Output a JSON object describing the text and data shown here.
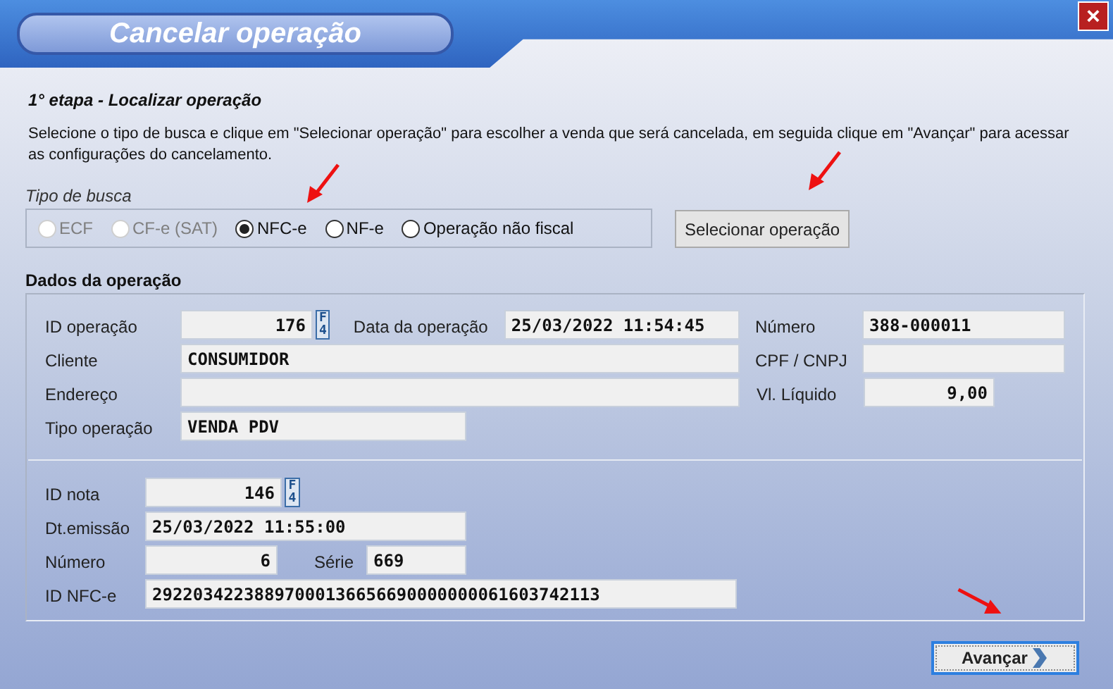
{
  "window": {
    "title": "Cancelar operação",
    "close": "×"
  },
  "step_title": "1° etapa - Localizar operação",
  "instructions": "Selecione o tipo de busca e clique em \"Selecionar operação\" para escolher a venda que será cancelada, em seguida clique em \"Avançar\" para acessar as configurações do cancelamento.",
  "search_type": {
    "label": "Tipo de busca",
    "options": [
      {
        "label": "ECF",
        "selected": false,
        "disabled": true
      },
      {
        "label": "CF-e (SAT)",
        "selected": false,
        "disabled": true
      },
      {
        "label": "NFC-e",
        "selected": true,
        "disabled": false
      },
      {
        "label": "NF-e",
        "selected": false,
        "disabled": false
      },
      {
        "label": "Operação não fiscal",
        "selected": false,
        "disabled": false
      }
    ]
  },
  "select_button": {
    "label": "Selecionar operação"
  },
  "operation": {
    "title": "Dados da operação",
    "id_operacao": {
      "label": "ID operação",
      "value": "176",
      "key": "F4"
    },
    "data_operacao": {
      "label": "Data da operação",
      "value": "25/03/2022 11:54:45"
    },
    "numero": {
      "label": "Número",
      "value": "388-000011"
    },
    "cliente": {
      "label": "Cliente",
      "value": "CONSUMIDOR"
    },
    "cpf_cnpj": {
      "label": "CPF / CNPJ"
    },
    "endereco": {
      "label": "Endereço"
    },
    "vl_liquido": {
      "label": "Vl. Líquido",
      "value": "9,00"
    },
    "tipo_operacao": {
      "label": "Tipo operação",
      "value": "VENDA PDV"
    }
  },
  "invoice": {
    "id_nota": {
      "label": "ID nota",
      "value": "146",
      "key": "F4"
    },
    "dt_emissao": {
      "label": "Dt.emissão",
      "value": "25/03/2022 11:55:00"
    },
    "numero": {
      "label": "Número",
      "value": "6"
    },
    "serie": {
      "label": "Série",
      "value": "669"
    },
    "id_nfce": {
      "label": "ID NFC-e",
      "value": "29220342238897000136656690000000061603742113"
    }
  },
  "next_button": {
    "label": "Avançar"
  }
}
